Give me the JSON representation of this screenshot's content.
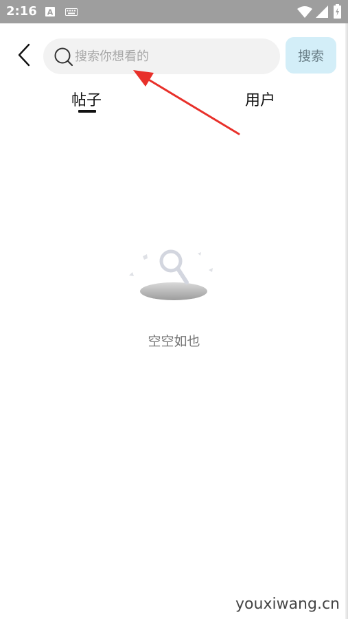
{
  "status_bar": {
    "time": "2:16",
    "icons": [
      "font-a-icon",
      "keyboard-icon",
      "wifi-icon",
      "signal-icon",
      "battery-icon"
    ]
  },
  "header": {
    "back_icon": "chevron-left-icon",
    "search": {
      "placeholder": "搜索你想看的",
      "value": "",
      "icon": "search-icon"
    },
    "search_button_label": "搜索"
  },
  "tabs": [
    {
      "label": "帖子",
      "selected": true
    },
    {
      "label": "用户",
      "selected": false
    }
  ],
  "empty_state": {
    "icon": "empty-search-illustration",
    "text": "空空如也"
  },
  "watermark": "youxiwang.cn",
  "colors": {
    "status_bar": "#9e9e9e",
    "search_bg": "#f2f2f2",
    "search_button_bg": "#d3eef8",
    "annotation_arrow": "#e8302a"
  }
}
